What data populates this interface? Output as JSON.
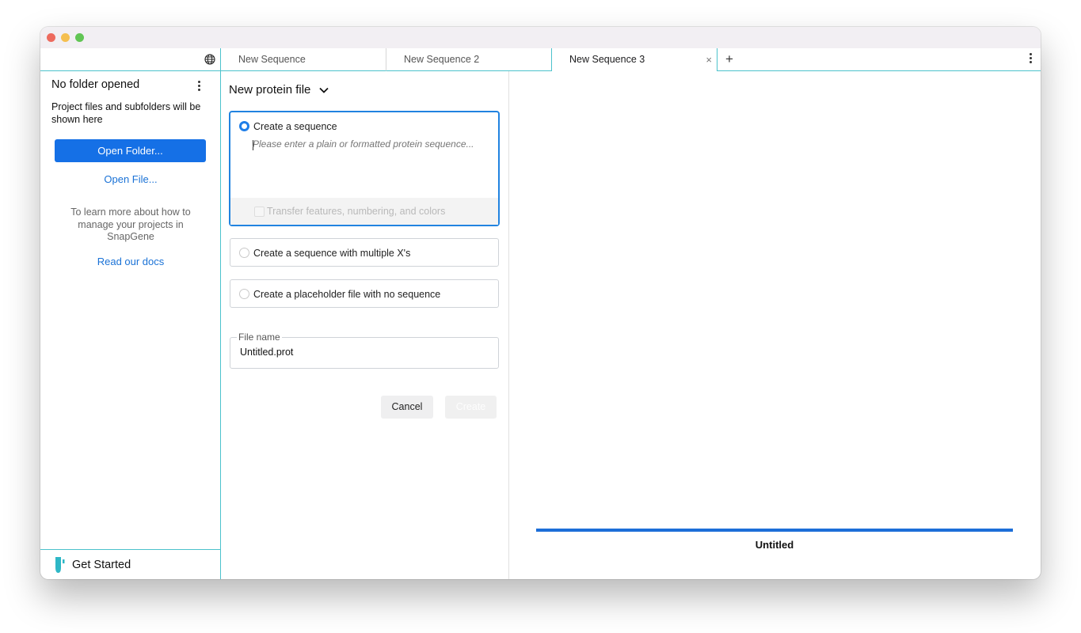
{
  "window": {
    "traffic_lights": [
      "close",
      "minimize",
      "maximize"
    ]
  },
  "tabs": [
    {
      "label": "New Sequence",
      "active": false
    },
    {
      "label": "New Sequence 2",
      "active": false
    },
    {
      "label": "New Sequence 3",
      "active": true,
      "close_icon": "×"
    }
  ],
  "tab_actions": {
    "add_label": "+",
    "menu_icon": "more-vertical-icon"
  },
  "sidebar": {
    "globe_icon": "globe-icon",
    "title": "No folder opened",
    "description": "Project files and subfolders will be shown here",
    "open_folder_label": "Open Folder...",
    "open_file_label": "Open File...",
    "learn_text": "To learn more about how to manage your projects in SnapGene",
    "docs_link": "Read our docs",
    "get_started_label": "Get Started"
  },
  "form": {
    "title": "New protein file",
    "options": [
      {
        "label": "Create a sequence",
        "selected": true
      },
      {
        "label": "Create a sequence with multiple X's",
        "selected": false
      },
      {
        "label": "Create a placeholder file with no sequence",
        "selected": false
      }
    ],
    "sequence_placeholder": "Please enter a plain or formatted protein sequence...",
    "sequence_value": "",
    "transfer_label": "Transfer features, numbering, and colors",
    "transfer_checked": false,
    "file_name_label": "File name",
    "file_name_value": "Untitled.prot",
    "cancel_label": "Cancel",
    "create_label": "Create"
  },
  "preview": {
    "sequence_name": "Untitled",
    "bar_color": "#1c6ed8"
  },
  "colors": {
    "accent": "#1570e6",
    "divider": "#4cc2cc",
    "link": "#1a72d6"
  }
}
